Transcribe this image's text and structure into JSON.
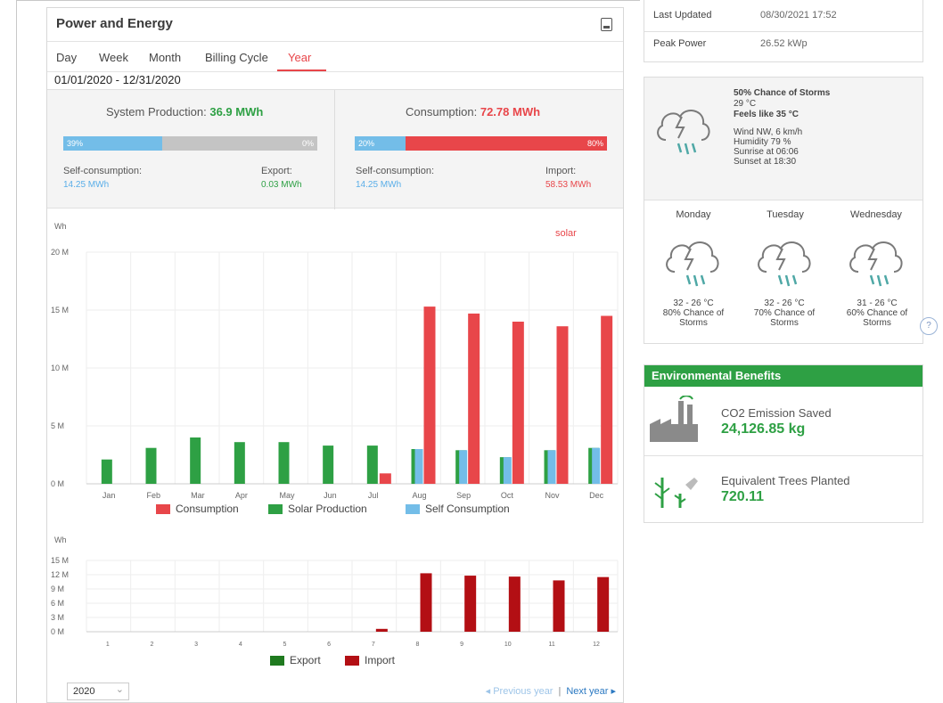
{
  "panel": {
    "title": "Power and Energy",
    "export_icon": "document-export-icon",
    "tabs": [
      "Day",
      "Week",
      "Month",
      "Billing Cycle",
      "Year"
    ],
    "active_tab": "Year",
    "date_range": "01/01/2020 - 12/31/2020"
  },
  "production": {
    "head_label": "System Production:",
    "head_value": "36.9 MWh",
    "bar_left_pct_label": "39%",
    "bar_right_pct_label": "0%",
    "bar_fill_fraction": 0.39,
    "self_label": "Self-consumption:",
    "self_value": "14.25 MWh",
    "export_label": "Export:",
    "export_value": "0.03 MWh"
  },
  "consumption": {
    "head_label": "Consumption:",
    "head_value": "72.78 MWh",
    "bar_left_pct_label": "20%",
    "bar_right_pct_label": "80%",
    "bar_fill_fraction": 0.2,
    "self_label": "Self-consumption:",
    "self_value": "14.25 MWh",
    "import_label": "Import:",
    "import_value": "58.53 MWh"
  },
  "brand_logo": "solar",
  "chart_data": [
    {
      "type": "bar",
      "ylabel": "Wh",
      "yticks": [
        "20 M",
        "15 M",
        "10 M",
        "5 M",
        "0 M"
      ],
      "ylim": [
        0,
        20000000
      ],
      "categories": [
        "Jan",
        "Feb",
        "Mar",
        "Apr",
        "May",
        "Jun",
        "Jul",
        "Aug",
        "Sep",
        "Oct",
        "Nov",
        "Dec"
      ],
      "series": [
        {
          "name": "Solar Production",
          "color": "#2ea044",
          "values": [
            2100000,
            3100000,
            4000000,
            3600000,
            3600000,
            3300000,
            3300000,
            3000000,
            2900000,
            2300000,
            2900000,
            3100000
          ]
        },
        {
          "name": "Consumption",
          "color": "#e8464a",
          "values": [
            0,
            0,
            0,
            0,
            0,
            0,
            900000,
            15300000,
            14700000,
            14000000,
            13600000,
            14500000
          ]
        },
        {
          "name": "Self Consumption",
          "color": "#73bde8",
          "values": [
            0,
            0,
            0,
            0,
            0,
            0,
            0,
            3000000,
            2900000,
            2300000,
            2900000,
            3100000
          ]
        }
      ],
      "legend": [
        "Consumption",
        "Solar Production",
        "Self Consumption"
      ],
      "legend_position": "bottom",
      "grid": true
    },
    {
      "type": "bar",
      "ylabel": "Wh",
      "yticks": [
        "15 M",
        "12 M",
        "9 M",
        "6 M",
        "3 M",
        "0 M"
      ],
      "ylim": [
        0,
        15000000
      ],
      "categories": [
        "1",
        "2",
        "3",
        "4",
        "5",
        "6",
        "7",
        "8",
        "9",
        "10",
        "11",
        "12"
      ],
      "series": [
        {
          "name": "Export",
          "color": "#1f7a1f",
          "values": [
            0,
            0,
            0,
            0,
            0,
            0,
            0,
            0,
            0,
            0,
            0,
            0
          ]
        },
        {
          "name": "Import",
          "color": "#b30f14",
          "values": [
            0,
            0,
            0,
            0,
            0,
            0,
            600000,
            12300000,
            11800000,
            11600000,
            10800000,
            11500000
          ]
        }
      ],
      "legend": [
        "Export",
        "Import"
      ],
      "legend_position": "bottom",
      "grid": true
    }
  ],
  "footer": {
    "year": "2020",
    "prev_label": "◂ Previous year",
    "separator": "|",
    "next_label": "Next year ▸"
  },
  "info": {
    "last_updated_label": "Last Updated",
    "last_updated_value": "08/30/2021 17:52",
    "peak_power_label": "Peak Power",
    "peak_power_value": "26.52 kWp"
  },
  "weather": {
    "icon": "storm-cloud-icon",
    "headline": "50% Chance of Storms",
    "temp": "29 °C",
    "feels_like": "Feels like 35 °C",
    "wind": "Wind NW, 6 km/h",
    "humidity": "Humidity 79 %",
    "sunrise": "Sunrise at 06:06",
    "sunset": "Sunset at 18:30",
    "days": [
      {
        "name": "Monday",
        "range": "32 - 26 °C",
        "chance": "80% Chance of",
        "cond": "Storms"
      },
      {
        "name": "Tuesday",
        "range": "32 - 26 °C",
        "chance": "70% Chance of",
        "cond": "Storms"
      },
      {
        "name": "Wednesday",
        "range": "31 - 26 °C",
        "chance": "60% Chance of",
        "cond": "Storms"
      }
    ]
  },
  "help": "?",
  "env": {
    "title": "Environmental Benefits",
    "co2_label": "CO2 Emission Saved",
    "co2_value": "24,126.85 kg",
    "co2_icon": "factory-icon",
    "trees_label": "Equivalent Trees Planted",
    "trees_value": "720.11",
    "trees_icon": "tree-icon"
  }
}
